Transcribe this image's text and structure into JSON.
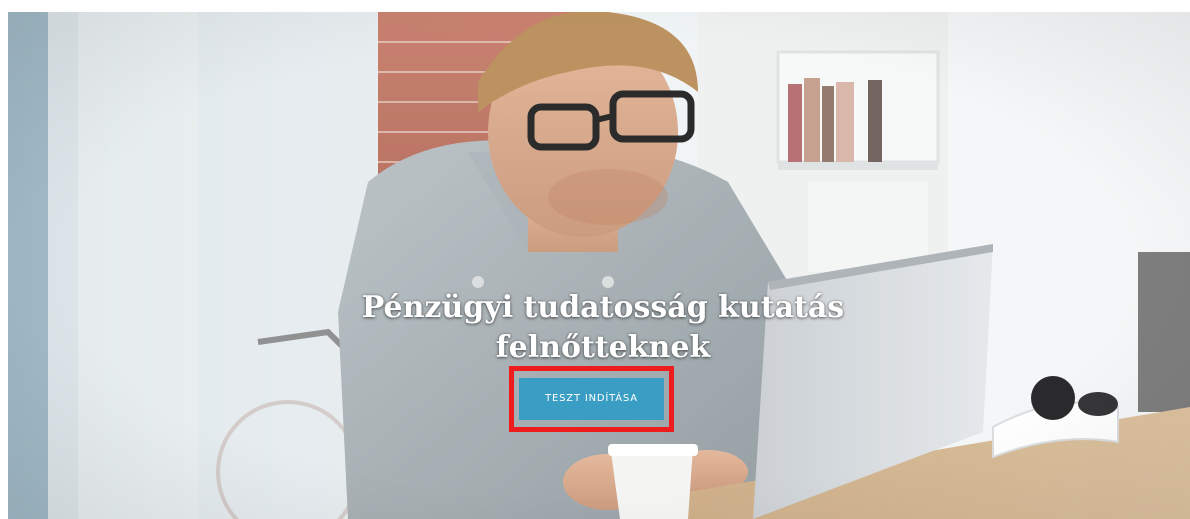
{
  "header": {
    "logo_fragment": "···"
  },
  "hero": {
    "title_line1": "Pénzügyi tudatosság kutatás",
    "title_line2": "felnőtteknek",
    "cta_label": "TESZT INDÍTÁSA",
    "background_image": "man-with-glasses-using-laptop-photo"
  },
  "colors": {
    "accent_button": "#3a9ec4",
    "highlight_frame": "#ee1c1c",
    "title_text": "#ffffff",
    "logo": "#2f9fc9"
  }
}
